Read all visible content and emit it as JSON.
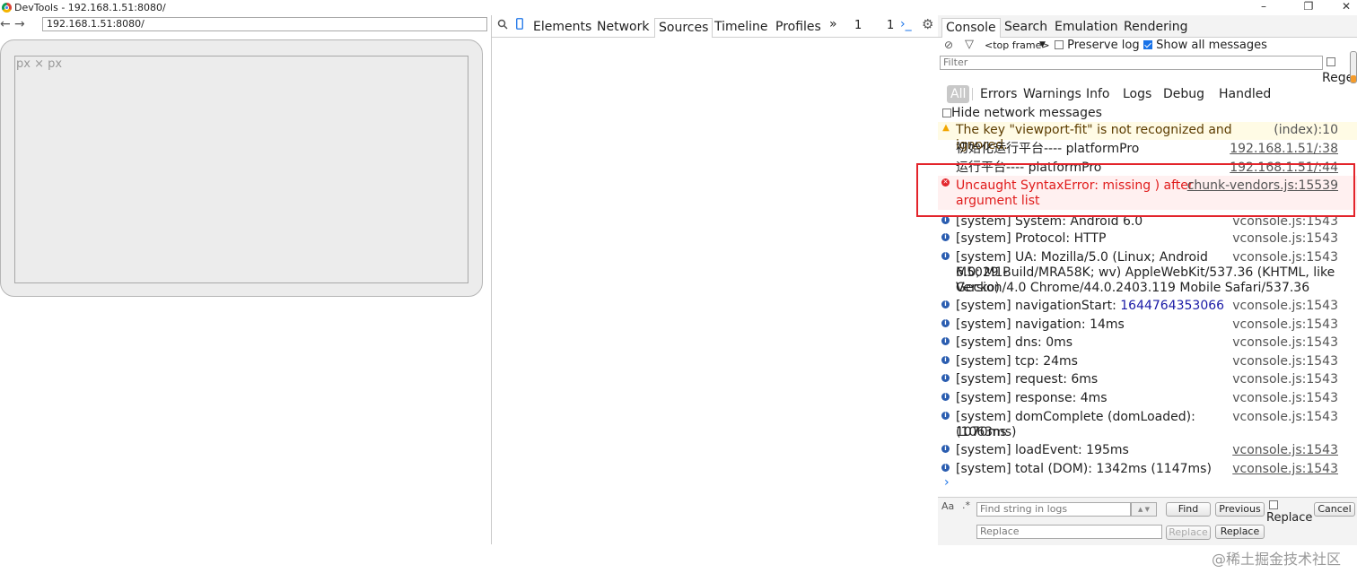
{
  "window": {
    "title": "DevTools - 192.168.1.51:8080/",
    "controls": {
      "minimize": "–",
      "restore": "❐",
      "close": "✕"
    }
  },
  "browser": {
    "back": "←",
    "forward": "→",
    "address": "192.168.1.51:8080/",
    "viewport_dims": "px × px"
  },
  "devtools": {
    "search_icon": "🔍",
    "device_icon": "▯",
    "tabs": [
      "Elements",
      "Network",
      "Sources",
      "Timeline",
      "Profiles"
    ],
    "more": "»",
    "errors_count": "1",
    "warnings_count": "1",
    "drawer_icon": "›_",
    "settings_icon": "⚙"
  },
  "drawer": {
    "tabs": [
      "Console",
      "Search",
      "Emulation",
      "Rendering"
    ],
    "clear_icon": "⊘",
    "filter_icon": "▽",
    "frame_select": "<top frame>",
    "frame_arrow": "▼",
    "preserve_log": "Preserve log",
    "show_all": "Show all messages",
    "filter_placeholder": "Filter",
    "regex": "Rege",
    "levels": [
      "All",
      "Errors",
      "Warnings",
      "Info",
      "Logs",
      "Debug",
      "Handled"
    ],
    "hide_network": "Hide network messages",
    "prompt": "›"
  },
  "messages": [
    {
      "type": "warn",
      "icon": "▲",
      "text": "The key \"viewport-fit\" is not recognized and ignored.",
      "source": "(index):10",
      "source_link": false
    },
    {
      "type": "log",
      "text": "初始化运行平台---- platformPro",
      "source": "192.168.1.51/:38",
      "source_link": true
    },
    {
      "type": "log",
      "text": "运行平台---- platformPro",
      "source": "192.168.1.51/:44",
      "source_link": true
    },
    {
      "type": "error",
      "icon": "✕",
      "text": "Uncaught SyntaxError: missing ) after",
      "text2": "argument list",
      "source": "chunk-vendors.js:15539",
      "source_link": true
    },
    {
      "type": "info",
      "icon": "i",
      "text": "[system] System: Android 6.0",
      "source": "vconsole.js:1543",
      "source_link": false
    },
    {
      "type": "info",
      "icon": "i",
      "text": "[system] Protocol: HTTP",
      "source": "vconsole.js:1543",
      "source_link": false
    },
    {
      "type": "info",
      "icon": "i",
      "text": "[system] UA: Mozilla/5.0 (Linux; Android 6.0; M1-",
      "text2": "M5029 Build/MRA58K; wv) AppleWebKit/537.36 (KHTML, like Gecko)",
      "text3": "Version/4.0 Chrome/44.0.2403.119 Mobile Safari/537.36",
      "source": "vconsole.js:1543",
      "source_link": false
    },
    {
      "type": "info",
      "icon": "i",
      "text": "[system] navigationStart: ",
      "number": "1644764353066",
      "source": "vconsole.js:1543",
      "source_link": false
    },
    {
      "type": "info",
      "icon": "i",
      "text": "[system] navigation: 14ms",
      "source": "vconsole.js:1543",
      "source_link": false
    },
    {
      "type": "info",
      "icon": "i",
      "text": "[system] dns: 0ms",
      "source": "vconsole.js:1543",
      "source_link": false
    },
    {
      "type": "info",
      "icon": "i",
      "text": "[system] tcp: 24ms",
      "source": "vconsole.js:1543",
      "source_link": false
    },
    {
      "type": "info",
      "icon": "i",
      "text": "[system] request: 6ms",
      "source": "vconsole.js:1543",
      "source_link": false
    },
    {
      "type": "info",
      "icon": "i",
      "text": "[system] response: 4ms",
      "source": "vconsole.js:1543",
      "source_link": false
    },
    {
      "type": "info",
      "icon": "i",
      "text": "[system] domComplete (domLoaded): 1070ms",
      "text2": "(1063ms)",
      "source": "vconsole.js:1543",
      "source_link": false
    },
    {
      "type": "info",
      "icon": "i",
      "text": "[system] loadEvent: 195ms",
      "source": "vconsole.js:1543",
      "source_link": true
    },
    {
      "type": "info",
      "icon": "i",
      "text": "[system] total (DOM): 1342ms (1147ms)",
      "source": "vconsole.js:1543",
      "source_link": true
    }
  ],
  "findbar": {
    "case_icon": "Aa",
    "regex_icon": ".*",
    "find_placeholder": "Find string in logs",
    "up": "▲",
    "down": "▼",
    "find": "Find",
    "previous": "Previous",
    "replace_label": "Replace",
    "cancel": "Cancel",
    "replace_placeholder": "Replace",
    "replace_btn": "Replace",
    "replace_all_btn": "Replace"
  },
  "watermark": "@稀土掘金技术社区"
}
